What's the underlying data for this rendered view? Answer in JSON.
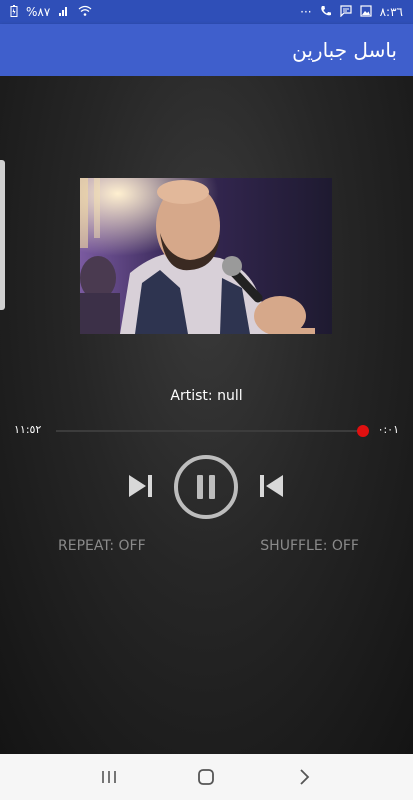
{
  "status_bar": {
    "battery_text": "%٨٧",
    "time": "٨:٣٦",
    "more": "···"
  },
  "app_bar": {
    "title": "باسل جبارين"
  },
  "player": {
    "artist_text": "Artist: null",
    "elapsed_time": "٠:٠١",
    "total_time": "١١:٥٢",
    "progress_fraction": 0.01,
    "repeat_label": "REPEAT: OFF",
    "shuffle_label": "SHUFFLE: OFF",
    "accent_color": "#e01010"
  },
  "icons": {
    "next": "skip-next-icon",
    "play_pause": "pause-icon",
    "prev": "skip-previous-icon"
  },
  "nav_bar": {
    "recents": "recents-icon",
    "home": "home-icon",
    "back": "back-icon"
  }
}
